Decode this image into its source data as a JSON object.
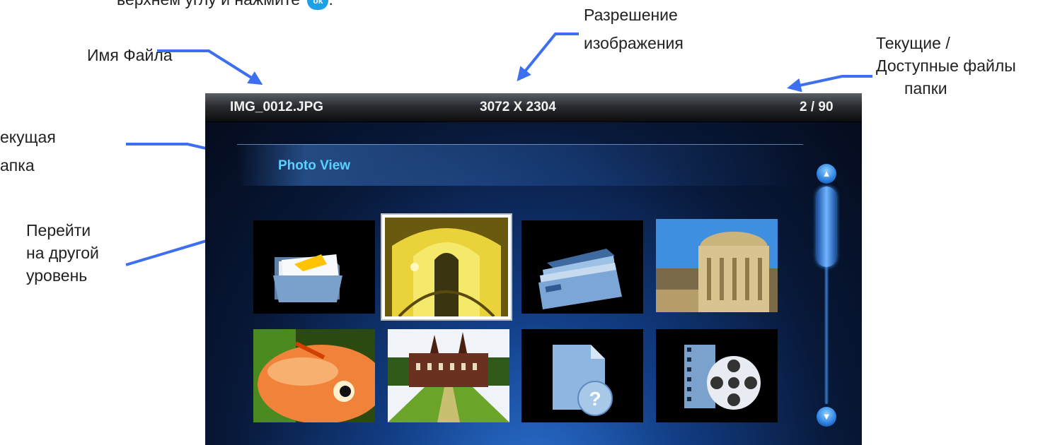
{
  "top_instruction": {
    "text": "верхнем углу и нажмите",
    "ok_label": "ok",
    "suffix": "."
  },
  "annotations": {
    "file_name": "Имя Файла",
    "resolution_line1": "Разрешение",
    "resolution_line2": "изображения",
    "files_count_line1": "Текущие /",
    "files_count_line2": "Доступные файлы",
    "files_count_line3": "папки",
    "current_folder_line1": "екущая",
    "current_folder_line2": "апка",
    "goto_level_line1": "Перейти",
    "goto_level_line2": "на другой",
    "goto_level_line3": "уровень"
  },
  "device": {
    "file_name": "IMG_0012.JPG",
    "resolution": "3072 X 2304",
    "file_counter": "2 / 90",
    "folder_title": "Photo View",
    "scroll_up_icon": "triangle-up-icon",
    "scroll_down_icon": "triangle-down-icon",
    "tiles": [
      {
        "name": "folder-up-tile",
        "icon": "folder-open-icon",
        "selected": false
      },
      {
        "name": "photo-tile-cathedral-interior",
        "icon": "photo-thumbnail",
        "selected": true
      },
      {
        "name": "folder-tile",
        "icon": "folder-stack-icon",
        "selected": false
      },
      {
        "name": "photo-tile-radcliffe-camera",
        "icon": "photo-thumbnail",
        "selected": false
      },
      {
        "name": "photo-tile-fish",
        "icon": "photo-thumbnail",
        "selected": false
      },
      {
        "name": "photo-tile-castle",
        "icon": "photo-thumbnail",
        "selected": false
      },
      {
        "name": "unknown-file-tile",
        "icon": "question-file-icon",
        "selected": false
      },
      {
        "name": "video-file-tile",
        "icon": "film-reel-icon",
        "selected": false
      }
    ]
  },
  "colors": {
    "arrow": "#3d6ff0",
    "folder_title": "#5ad0ff",
    "ok_pill": "#1ea0e6"
  }
}
